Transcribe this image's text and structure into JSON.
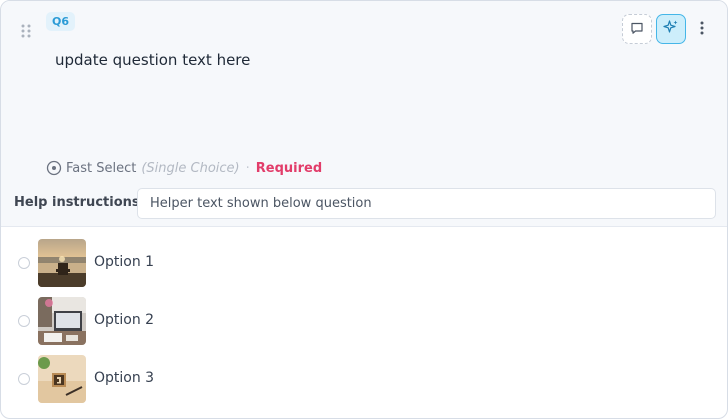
{
  "question": {
    "badge": "Q6",
    "text": "update question text here",
    "type_label": "Fast Select",
    "type_sub": "(Single Choice)",
    "separator": "·",
    "required_label": "Required"
  },
  "toolbar": {
    "comment_icon": "comment-icon",
    "ai_icon": "sparkles-icon",
    "more_icon": "more-vertical-icon"
  },
  "help": {
    "label": "Help instructions:",
    "value": "Helper text shown below question"
  },
  "options": [
    {
      "label": "Option 1",
      "image": "lakeside-chair-sunset-photo"
    },
    {
      "label": "Option 2",
      "image": "desk-laptop-photo"
    },
    {
      "label": "Option 3",
      "image": "wooden-block-number-3-photo"
    }
  ],
  "colors": {
    "accent": "#2b9bd6",
    "required": "#e23d6a",
    "ai_button_bg": "#cdeefb"
  }
}
